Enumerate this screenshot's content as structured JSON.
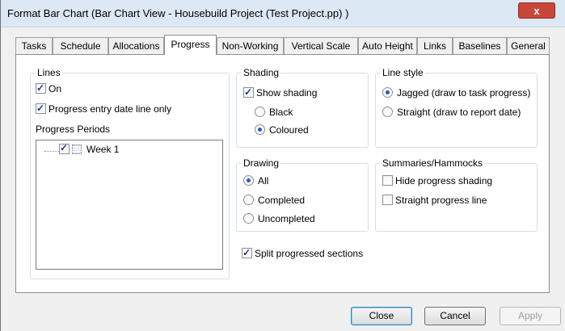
{
  "window": {
    "title": "Format Bar Chart (Bar Chart View - Housebuild Project (Test Project.pp) )",
    "close_glyph": "x"
  },
  "tabs": [
    {
      "label": "Tasks"
    },
    {
      "label": "Schedule"
    },
    {
      "label": "Allocations"
    },
    {
      "label": "Progress",
      "active": true
    },
    {
      "label": "Non-Working"
    },
    {
      "label": "Vertical Scale"
    },
    {
      "label": "Auto Height"
    },
    {
      "label": "Links"
    },
    {
      "label": "Baselines"
    },
    {
      "label": "General"
    }
  ],
  "lines": {
    "title": "Lines",
    "on_label": "On",
    "on_checked": true,
    "progress_entry_label": "Progress entry date line only",
    "progress_entry_checked": true,
    "periods_label": "Progress Periods",
    "periods": [
      {
        "label": "Week 1",
        "checked": true
      }
    ]
  },
  "shading": {
    "title": "Shading",
    "show_label": "Show shading",
    "show_checked": true,
    "black_label": "Black",
    "coloured_label": "Coloured",
    "selected": "Coloured"
  },
  "line_style": {
    "title": "Line style",
    "jagged_label": "Jagged (draw to task progress)",
    "straight_label": "Straight (draw to report date)",
    "selected": "Jagged"
  },
  "drawing": {
    "title": "Drawing",
    "all_label": "All",
    "completed_label": "Completed",
    "uncompleted_label": "Uncompleted",
    "selected": "All"
  },
  "summaries": {
    "title": "Summaries/Hammocks",
    "hide_label": "Hide progress shading",
    "hide_checked": false,
    "straight_label": "Straight progress line",
    "straight_checked": false
  },
  "split": {
    "label": "Split progressed sections",
    "checked": true
  },
  "buttons": {
    "close": "Close",
    "cancel": "Cancel",
    "apply": "Apply"
  }
}
